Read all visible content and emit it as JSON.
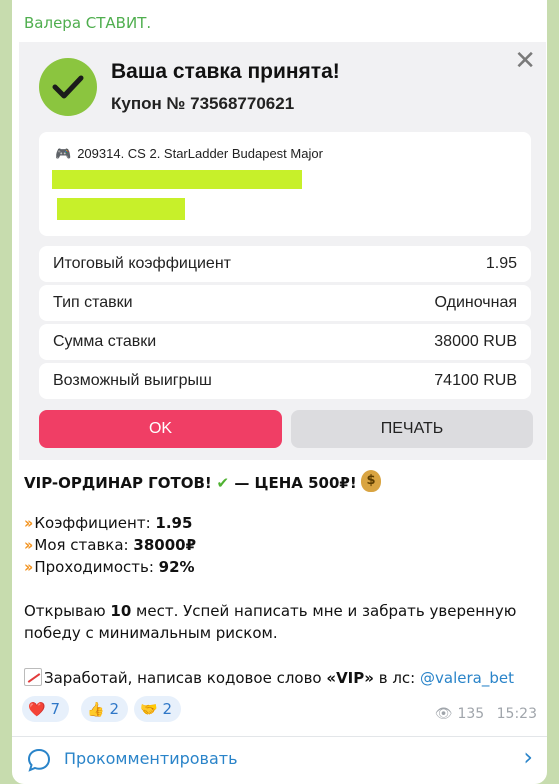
{
  "channel": {
    "name": "Валера СТАВИТ."
  },
  "shot": {
    "title": "Ваша ставка принята!",
    "coupon": "Купон № 73568770621",
    "close_icon": "close-icon",
    "event": "209314. CS 2. StarLadder Budapest Major",
    "rows": [
      {
        "key": "Итоговый коэффициент",
        "value": "1.95"
      },
      {
        "key": "Тип ставки",
        "value": "Одиночная"
      },
      {
        "key": "Сумма ставки",
        "value": "38000 RUB"
      },
      {
        "key": "Возможный выигрыш",
        "value": "74100 RUB"
      }
    ],
    "ok_label": "OK",
    "print_label": "ПЕЧАТЬ",
    "colors": {
      "accent_pink": "#f03e65",
      "check_green": "#8bc53f",
      "highlight": "#c7f02a"
    }
  },
  "message": {
    "headline_a": "VIP-ОРДИНАР ГОТОВ!",
    "headline_b": " — ЦЕНА 500₽!",
    "coef_label": "Коэффициент: ",
    "coef_value": "1.95",
    "stake_label": "Моя ставка: ",
    "stake_value": "38000₽",
    "pass_label": "Проходимость: ",
    "pass_value": "92%",
    "p1_a": "Открываю ",
    "p1_b": "10",
    "p1_c": " мест. Успей написать мне и забрать уверенную",
    "p1_d": "победу с минимальным риском.",
    "p2_a": "Заработай, написав кодовое слово ",
    "p2_b": "«VIP»",
    "p2_c": " в лс: ",
    "mention": "@valera_bet"
  },
  "reactions": [
    {
      "emoji": "❤️",
      "count": "7"
    },
    {
      "emoji": "👍",
      "count": "2"
    },
    {
      "emoji": "🤝",
      "count": "2"
    }
  ],
  "meta": {
    "views": "135",
    "time": "15:23"
  },
  "comment": {
    "label": "Прокомментировать"
  }
}
